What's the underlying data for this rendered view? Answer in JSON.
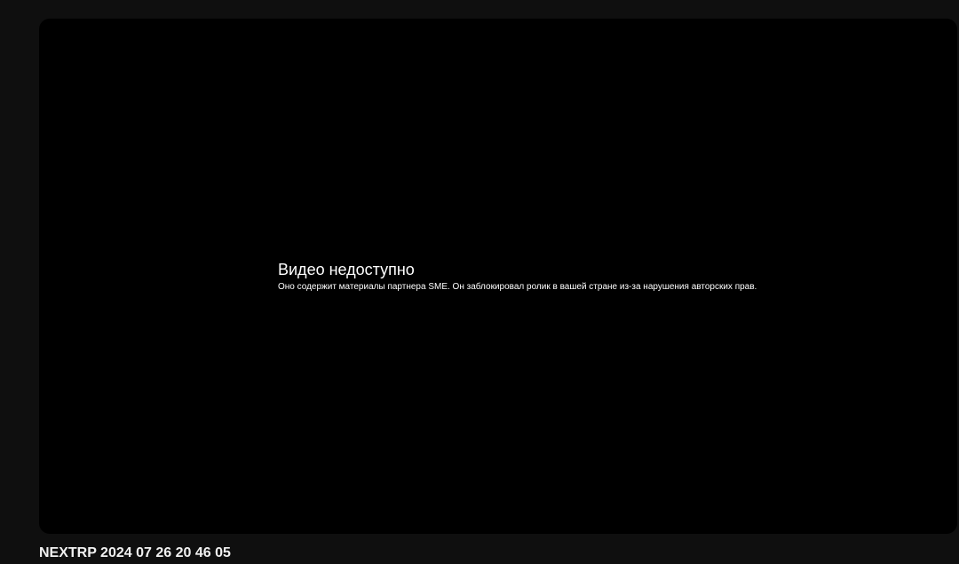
{
  "player": {
    "error_title": "Видео недоступно",
    "error_message": "Оно содержит материалы партнера SME. Он заблокировал ролик в вашей стране из-за нарушения авторских прав."
  },
  "video": {
    "title": "NEXTRP 2024 07 26 20 46 05"
  },
  "colors": {
    "page_background": "#0f0f0f",
    "player_background": "#000000",
    "text": "#ffffff"
  }
}
